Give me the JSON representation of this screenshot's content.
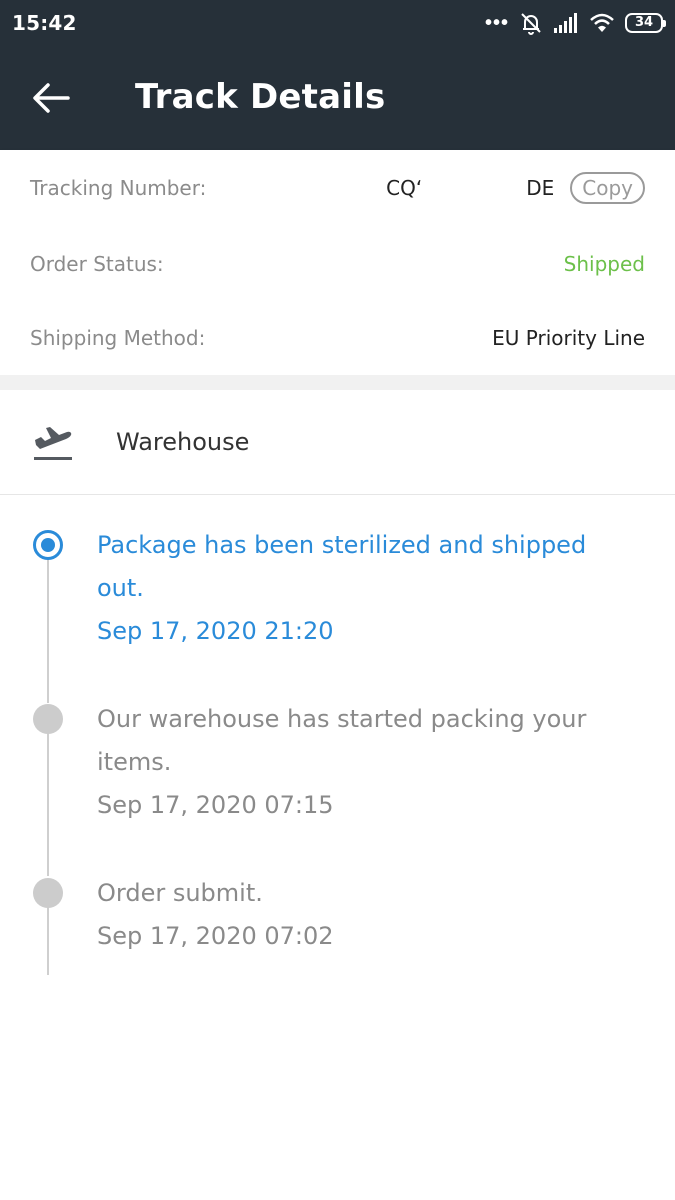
{
  "status_bar": {
    "time": "15:42",
    "battery": "34",
    "icons": [
      "more-dots-icon",
      "alarm-off-icon",
      "signal-icon",
      "wifi-icon",
      "battery-icon"
    ]
  },
  "header": {
    "title": "Track Details",
    "back_icon": "back-arrow-icon"
  },
  "info": {
    "tracking_label": "Tracking Number:",
    "tracking_prefix": "CQʻ",
    "tracking_suffix": "DE",
    "copy_label": "Copy",
    "status_label": "Order Status:",
    "status_value": "Shipped",
    "method_label": "Shipping Method:",
    "method_value": "EU Priority Line"
  },
  "section": {
    "icon": "flight-takeoff-icon",
    "label": "Warehouse"
  },
  "events": [
    {
      "message": "Package has been sterilized and shipped out.",
      "time": "Sep 17, 2020 21:20",
      "active": true
    },
    {
      "message": "Our warehouse has started packing your items.",
      "time": "Sep 17, 2020 07:15",
      "active": false
    },
    {
      "message": "Order submit.",
      "time": "Sep 17, 2020 07:02",
      "active": false
    }
  ],
  "colors": {
    "appbar": "#263039",
    "accent": "#2a8bd9",
    "shipped": "#6cc04a",
    "muted": "#8a8a8a"
  }
}
